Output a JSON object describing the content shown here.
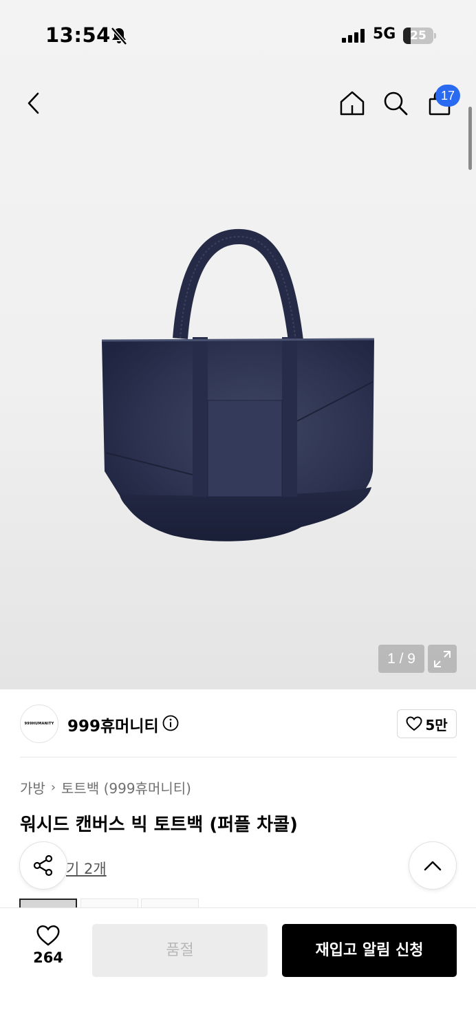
{
  "status_bar": {
    "time": "13:54",
    "network": "5G",
    "battery_level": "25",
    "battery_fraction": 0.25
  },
  "header": {
    "back_icon": "chevron-left-icon",
    "home_icon": "home-icon",
    "search_icon": "search-icon",
    "cart_icon": "shopping-bag-icon",
    "cart_count": "17",
    "cart_badge_color": "#2a6af0"
  },
  "gallery": {
    "counter": "1 / 9",
    "expand_icon": "expand-icon",
    "image_subject": "washed canvas big tote bag, purple charcoal"
  },
  "brand": {
    "logo_text": "999HUMANITY",
    "name": "999휴머니티",
    "info_icon": "info-icon",
    "like_icon": "heart-outline-icon",
    "like_count": "5만"
  },
  "breadcrumb": {
    "items": [
      "가방",
      "토트백 (999휴머니티)"
    ],
    "separator": "›"
  },
  "product": {
    "title": "워시드 캔버스 빅 토트백 (퍼플 차콜)",
    "reviews_label": "기 2개"
  },
  "floating": {
    "share_icon": "share-icon",
    "scroll_top_icon": "chevron-up-icon"
  },
  "bottom_bar": {
    "wish_icon": "heart-outline-icon",
    "wish_count": "264",
    "soldout_label": "품절",
    "restock_label": "재입고 알림 신청"
  }
}
